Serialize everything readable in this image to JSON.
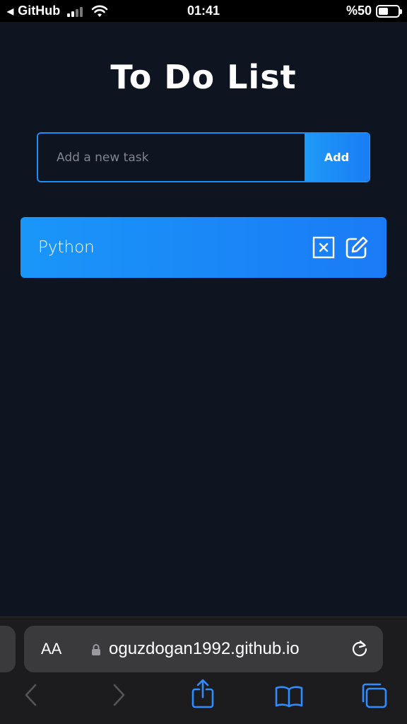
{
  "status_bar": {
    "back_label": "GitHub",
    "time": "01:41",
    "battery": "%50",
    "battery_level": 0.5
  },
  "app": {
    "title": "To Do List",
    "input": {
      "placeholder": "Add a new task",
      "value": ""
    },
    "add_label": "Add",
    "tasks": [
      {
        "text": "Python"
      }
    ]
  },
  "browser": {
    "text_size_label": "AA",
    "url": "oguzdogan1992.github.io"
  },
  "colors": {
    "background": "#0f1520",
    "accent": "#1e8ef7"
  }
}
